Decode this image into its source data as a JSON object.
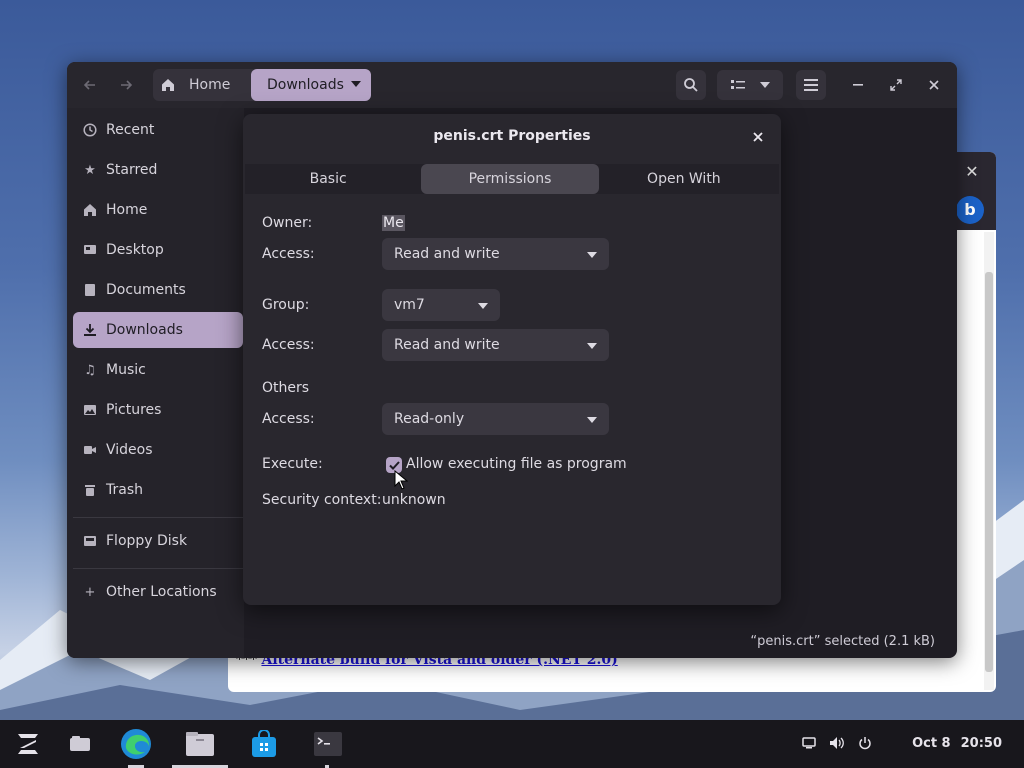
{
  "background_window": {
    "close_glyph": "✕",
    "link_prefix": "***",
    "link_text": "Alternate build for Vista and older (.NET 2.0)"
  },
  "file_manager": {
    "path": {
      "home_label": "Home",
      "current_label": "Downloads"
    },
    "sidebar": {
      "items": [
        {
          "label": "Recent",
          "icon": "clock-icon"
        },
        {
          "label": "Starred",
          "icon": "star-icon"
        },
        {
          "label": "Home",
          "icon": "home-icon"
        },
        {
          "label": "Desktop",
          "icon": "desktop-icon"
        },
        {
          "label": "Documents",
          "icon": "document-icon"
        },
        {
          "label": "Downloads",
          "icon": "download-icon",
          "active": true
        },
        {
          "label": "Music",
          "icon": "music-icon"
        },
        {
          "label": "Pictures",
          "icon": "picture-icon"
        },
        {
          "label": "Videos",
          "icon": "video-icon"
        },
        {
          "label": "Trash",
          "icon": "trash-icon"
        },
        {
          "label": "Floppy Disk",
          "icon": "floppy-icon"
        },
        {
          "label": "Other Locations",
          "icon": "plus-icon"
        }
      ]
    },
    "status": "“penis.crt” selected  (2.1 kB)"
  },
  "dialog": {
    "title": "penis.crt Properties",
    "tabs": [
      "Basic",
      "Permissions",
      "Open With"
    ],
    "active_tab": "Permissions",
    "owner_label": "Owner:",
    "owner_value": "Me",
    "owner_access_label": "Access:",
    "owner_access_value": "Read and write",
    "group_label": "Group:",
    "group_value": "vm7",
    "group_access_label": "Access:",
    "group_access_value": "Read and write",
    "others_label": "Others",
    "others_access_label": "Access:",
    "others_access_value": "Read-only",
    "execute_label": "Execute:",
    "execute_checkbox_label": "Allow executing file as program",
    "execute_checked": true,
    "security_label": "Security context:",
    "security_value": "unknown"
  },
  "taskbar": {
    "date": "Oct 8",
    "time": "20:50"
  },
  "colors": {
    "accent": "#b6a4c7",
    "window_bg": "#1f1d24",
    "dialog_bg": "#29272e",
    "taskbar_bg": "#18171c"
  }
}
